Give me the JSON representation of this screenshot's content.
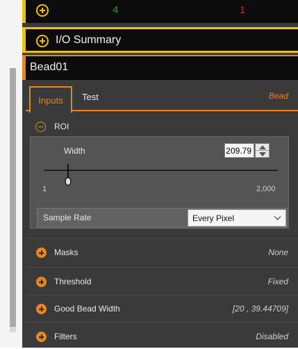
{
  "status_row": {
    "pass_count": "4",
    "fail_count": "1"
  },
  "io_summary": {
    "label": "I/O Summary"
  },
  "tool": {
    "name": "Bead01"
  },
  "tabs": {
    "inputs": "Inputs",
    "test": "Test",
    "tool_type": "Bead"
  },
  "roi": {
    "label": "ROI",
    "width_label": "Width",
    "width_value": "209.79",
    "slider_min": "1",
    "slider_max": "2,000",
    "sample_rate_label": "Sample Rate",
    "sample_rate_value": "Every Pixel"
  },
  "params": [
    {
      "label": "Masks",
      "value": "None"
    },
    {
      "label": "Threshold",
      "value": "Fixed"
    },
    {
      "label": "Good Bead Width",
      "value": "[20 , 39.44709]"
    },
    {
      "label": "Filters",
      "value": "Disabled"
    }
  ],
  "colors": {
    "accent_orange": "#e8861d",
    "accent_yellow": "#f2c100",
    "pass_green": "#2e9a2e",
    "fail_red": "#e02020"
  }
}
